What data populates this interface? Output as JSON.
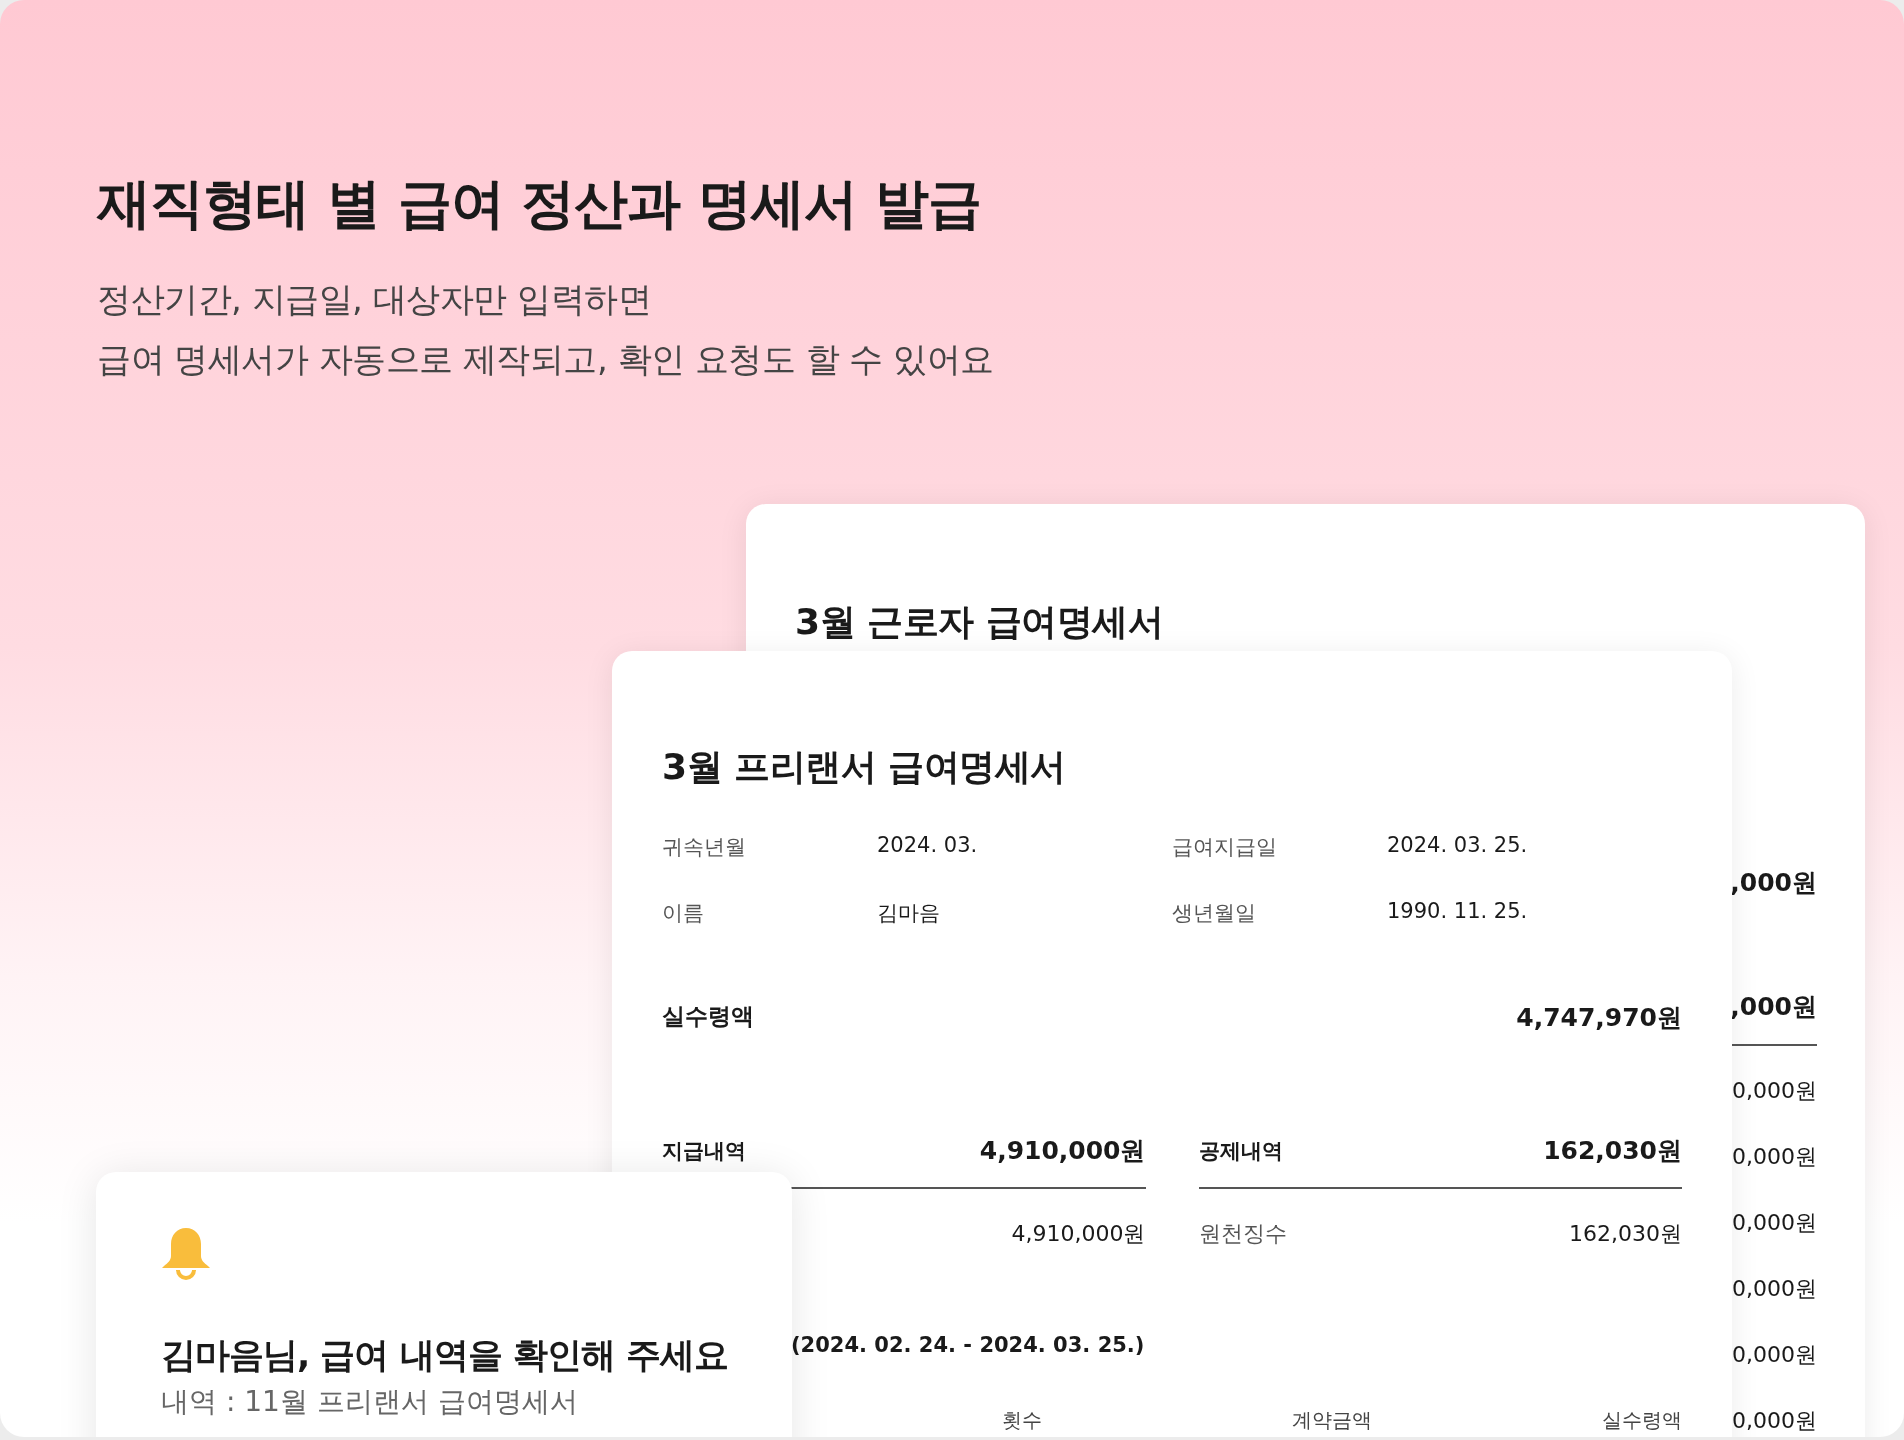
{
  "headline": "재직형태 별 급여 정산과 명세서 발급",
  "description_lines": [
    "정산기간, 지급일, 대상자만 입력하면",
    "급여 명세서가 자동으로 제작되고, 확인 요청도 할 수 있어요"
  ],
  "back_payslip": {
    "title": "3월 근로자 급여명세서",
    "column_3": [
      {
        "kind": "summary",
        "value": ",000원"
      },
      {
        "kind": "section",
        "value": ",000원"
      },
      {
        "kind": "item",
        "value": "0,000원"
      },
      {
        "kind": "item",
        "value": "0,000원"
      },
      {
        "kind": "item",
        "value": "0,000원"
      },
      {
        "kind": "item",
        "value": "0,000원"
      },
      {
        "kind": "item",
        "value": "0,000원"
      },
      {
        "kind": "item",
        "value": "0,000원"
      }
    ]
  },
  "front_payslip": {
    "title": "3월 프리랜서 급여명세서",
    "info": [
      {
        "label": "귀속년월",
        "value": "2024. 03."
      },
      {
        "label": "급여지급일",
        "value": "2024. 03. 25."
      },
      {
        "label": "이름",
        "value": "김마음"
      },
      {
        "label": "생년월일",
        "value": "1990. 11. 25."
      }
    ],
    "net_pay": {
      "label": "실수령액",
      "value": "4,747,970원"
    },
    "sections": [
      {
        "label": "지급내역",
        "total": "4,910,000원",
        "rows": [
          {
            "value": "4,910,000원"
          }
        ]
      },
      {
        "label": "공제내역",
        "total": "162,030원",
        "rows": [
          {
            "label": "원천징수",
            "value": "162,030원"
          }
        ]
      }
    ],
    "period": "(2024. 02. 24. - 2024. 03. 25.)",
    "table": {
      "columns": [
        "횟수",
        "계약금액",
        "실수령액"
      ]
    }
  },
  "notification": {
    "title": "김마음님, 급여 내역을 확인해 주세요",
    "detail": "내역 : 11월 프리랜서 급여명세서"
  }
}
